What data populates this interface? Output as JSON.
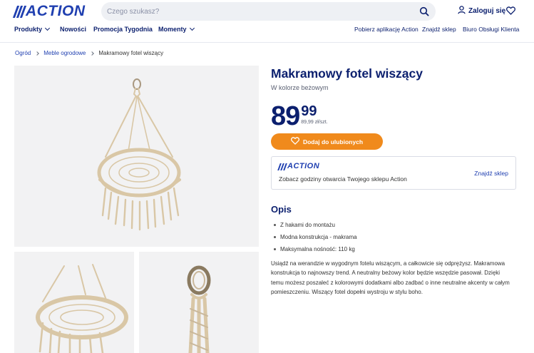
{
  "header": {
    "logo_text": "ACTION",
    "search_placeholder": "Czego szukasz?",
    "login_label": "Zaloguj się",
    "brand_color": "#1f3fb0",
    "accent_color": "#f08a1c"
  },
  "nav": {
    "products": "Produkty",
    "new": "Nowości",
    "promo": "Promocja Tygodnia",
    "moments": "Momenty",
    "app": "Pobierz aplikację Action",
    "find_store": "Znajdź sklep",
    "support": "Biuro Obsługi Klienta"
  },
  "breadcrumb": {
    "items": [
      "Ogród",
      "Meble ogrodowe"
    ],
    "current": "Makramowy fotel wiszący"
  },
  "product": {
    "title": "Makramowy fotel wiszący",
    "subtitle": "W kolorze beżowym",
    "price_int": "89",
    "price_dec": "99",
    "price_unit": "89,99 zł/szt.",
    "fav_button": "Dodaj do ulubionych"
  },
  "store": {
    "logo_text": "ACTION",
    "text": "Zobacz godziny otwarcia Twojego sklepu Action",
    "link": "Znajdź sklep"
  },
  "description": {
    "title": "Opis",
    "bullets": [
      "Z hakami do montażu",
      "Modna konstrukcja - makrama",
      "Maksymalna nośność: 110 kg"
    ],
    "text": "Usiądź na werandzie w wygodnym fotelu wiszącym, a całkowicie się odprężysz. Makramowa konstrukcja to najnowszy trend. A neutralny beżowy kolor będzie wszędzie pasował. Dzięki temu możesz poszaleć z kolorowymi dodatkami albo zadbać o inne neutralne akcenty w całym pomieszczeniu. Wiszący fotel dopełni wystroju w stylu boho."
  },
  "icons": {
    "search": "search-icon",
    "user": "user-icon",
    "heart": "heart-icon",
    "chevron": "chevron-down-icon"
  }
}
